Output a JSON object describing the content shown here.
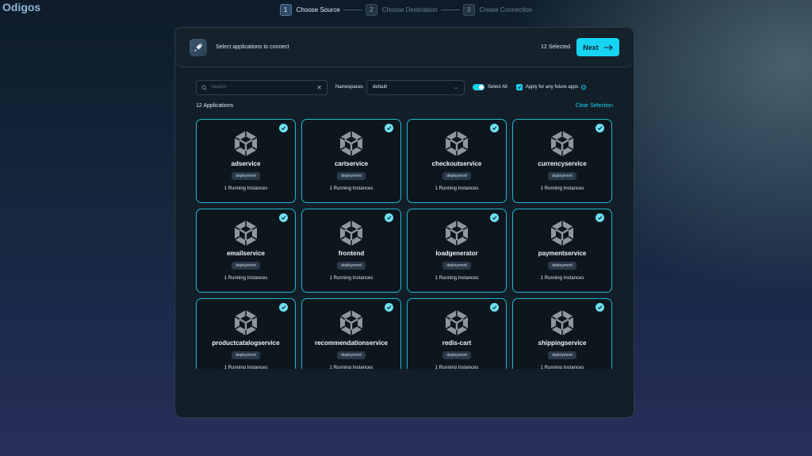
{
  "brand": "Odigos",
  "steps": [
    {
      "num": "1",
      "label": "Choose Source"
    },
    {
      "num": "2",
      "label": "Choose Destination"
    },
    {
      "num": "3",
      "label": "Create Connection"
    }
  ],
  "header": {
    "title": "Select applications to connect",
    "selected": "12 Selected",
    "next_label": "Next"
  },
  "toolbar": {
    "search_placeholder": "Search",
    "namespaces_label": "Namespaces",
    "namespace_value": "default",
    "select_all_label": "Select All",
    "future_apps_label": "Apply for any future apps"
  },
  "list": {
    "count_label": "12 Applications",
    "clear_selection": "Clear Selection"
  },
  "apps": [
    {
      "name": "adservice",
      "kind": "deployment",
      "instances": "1 Running Instances"
    },
    {
      "name": "cartservice",
      "kind": "deployment",
      "instances": "1 Running Instances"
    },
    {
      "name": "checkoutservice",
      "kind": "deployment",
      "instances": "1 Running Instances"
    },
    {
      "name": "currencyservice",
      "kind": "deployment",
      "instances": "1 Running Instances"
    },
    {
      "name": "emailservice",
      "kind": "deployment",
      "instances": "1 Running Instances"
    },
    {
      "name": "frontend",
      "kind": "deployment",
      "instances": "1 Running Instances"
    },
    {
      "name": "loadgenerator",
      "kind": "deployment",
      "instances": "1 Running Instances"
    },
    {
      "name": "paymentservice",
      "kind": "deployment",
      "instances": "1 Running Instances"
    },
    {
      "name": "productcatalogservice",
      "kind": "deployment",
      "instances": "1 Running Instances"
    },
    {
      "name": "recommendationservice",
      "kind": "deployment",
      "instances": "1 Running Instances"
    },
    {
      "name": "redis-cart",
      "kind": "deployment",
      "instances": "1 Running Instances"
    },
    {
      "name": "shippingservice",
      "kind": "deployment",
      "instances": "1 Running Instances"
    }
  ],
  "colors": {
    "accent": "#17d4f2",
    "card_border": "#1fb8cc",
    "panel_bg": "#131f28"
  }
}
